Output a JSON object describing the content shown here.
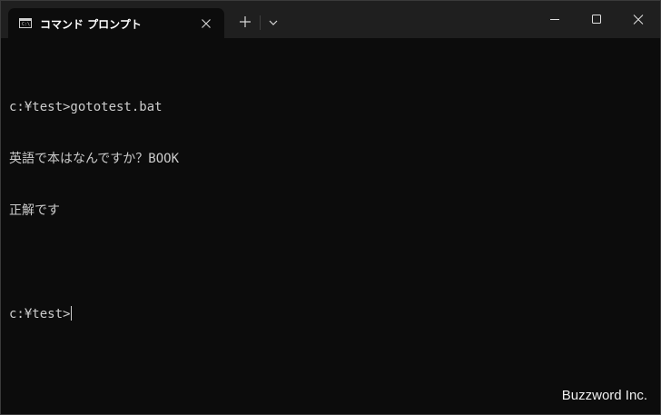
{
  "tab": {
    "title": "コマンド プロンプト",
    "icon_text": "C:\\",
    "icon": "terminal-icon"
  },
  "window_controls": {
    "close_tab_icon": "close-icon",
    "new_tab_icon": "plus-icon",
    "dropdown_icon": "chevron-down-icon",
    "minimize_icon": "minimize-icon",
    "maximize_icon": "maximize-icon",
    "close_icon": "close-icon"
  },
  "console": {
    "lines": [
      "c:¥test>gototest.bat",
      "英語で本はなんですか？BOOK",
      "正解です",
      "",
      "c:¥test>"
    ]
  },
  "watermark": "Buzzword Inc.",
  "colors": {
    "background": "#0c0c0c",
    "titlebar": "#1f1f1f",
    "text": "#cccccc"
  }
}
